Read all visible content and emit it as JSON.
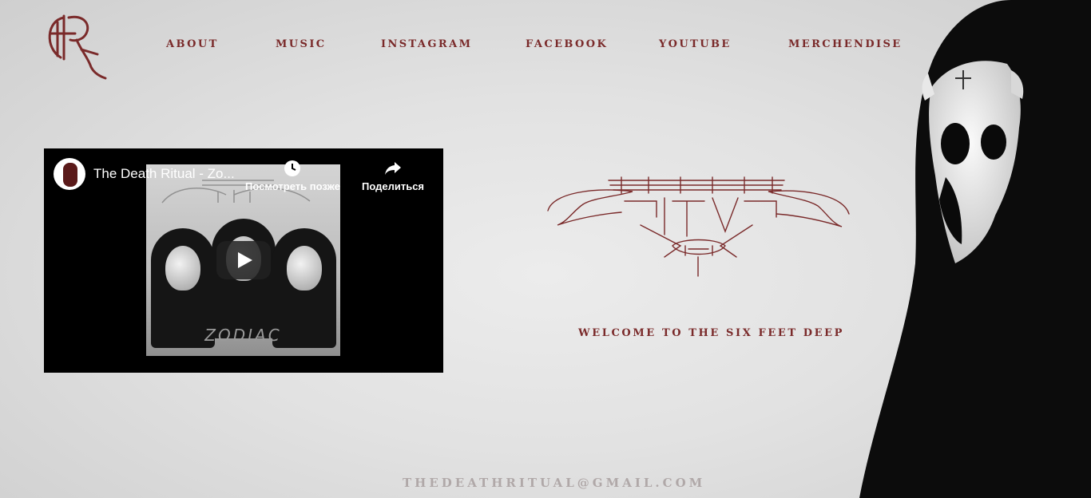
{
  "logo_name": "band-monogram-logo",
  "nav": {
    "items": [
      {
        "label": "ABOUT"
      },
      {
        "label": "MUSIC"
      },
      {
        "label": "INSTAGRAM"
      },
      {
        "label": "FACEBOOK"
      },
      {
        "label": "YOUTUBE"
      },
      {
        "label": "MERCHENDISE"
      }
    ]
  },
  "video": {
    "title": "The Death Ritual - Zo...",
    "watch_later_label": "Посмотреть позже",
    "share_label": "Поделиться",
    "thumbnail_text": "ZODIAC",
    "icons": {
      "watch_later": "clock-icon",
      "share": "share-arrow-icon",
      "play": "play-icon"
    }
  },
  "hero": {
    "welcome_text": "WELCOME TO THE SIX FEET DEEP"
  },
  "footer": {
    "email": "THEDEATHRITUAL@GMAIL.COM"
  },
  "colors": {
    "accent": "#7a2a2a",
    "background": "#e2e2e2",
    "email_text": "#b0a8a8"
  }
}
